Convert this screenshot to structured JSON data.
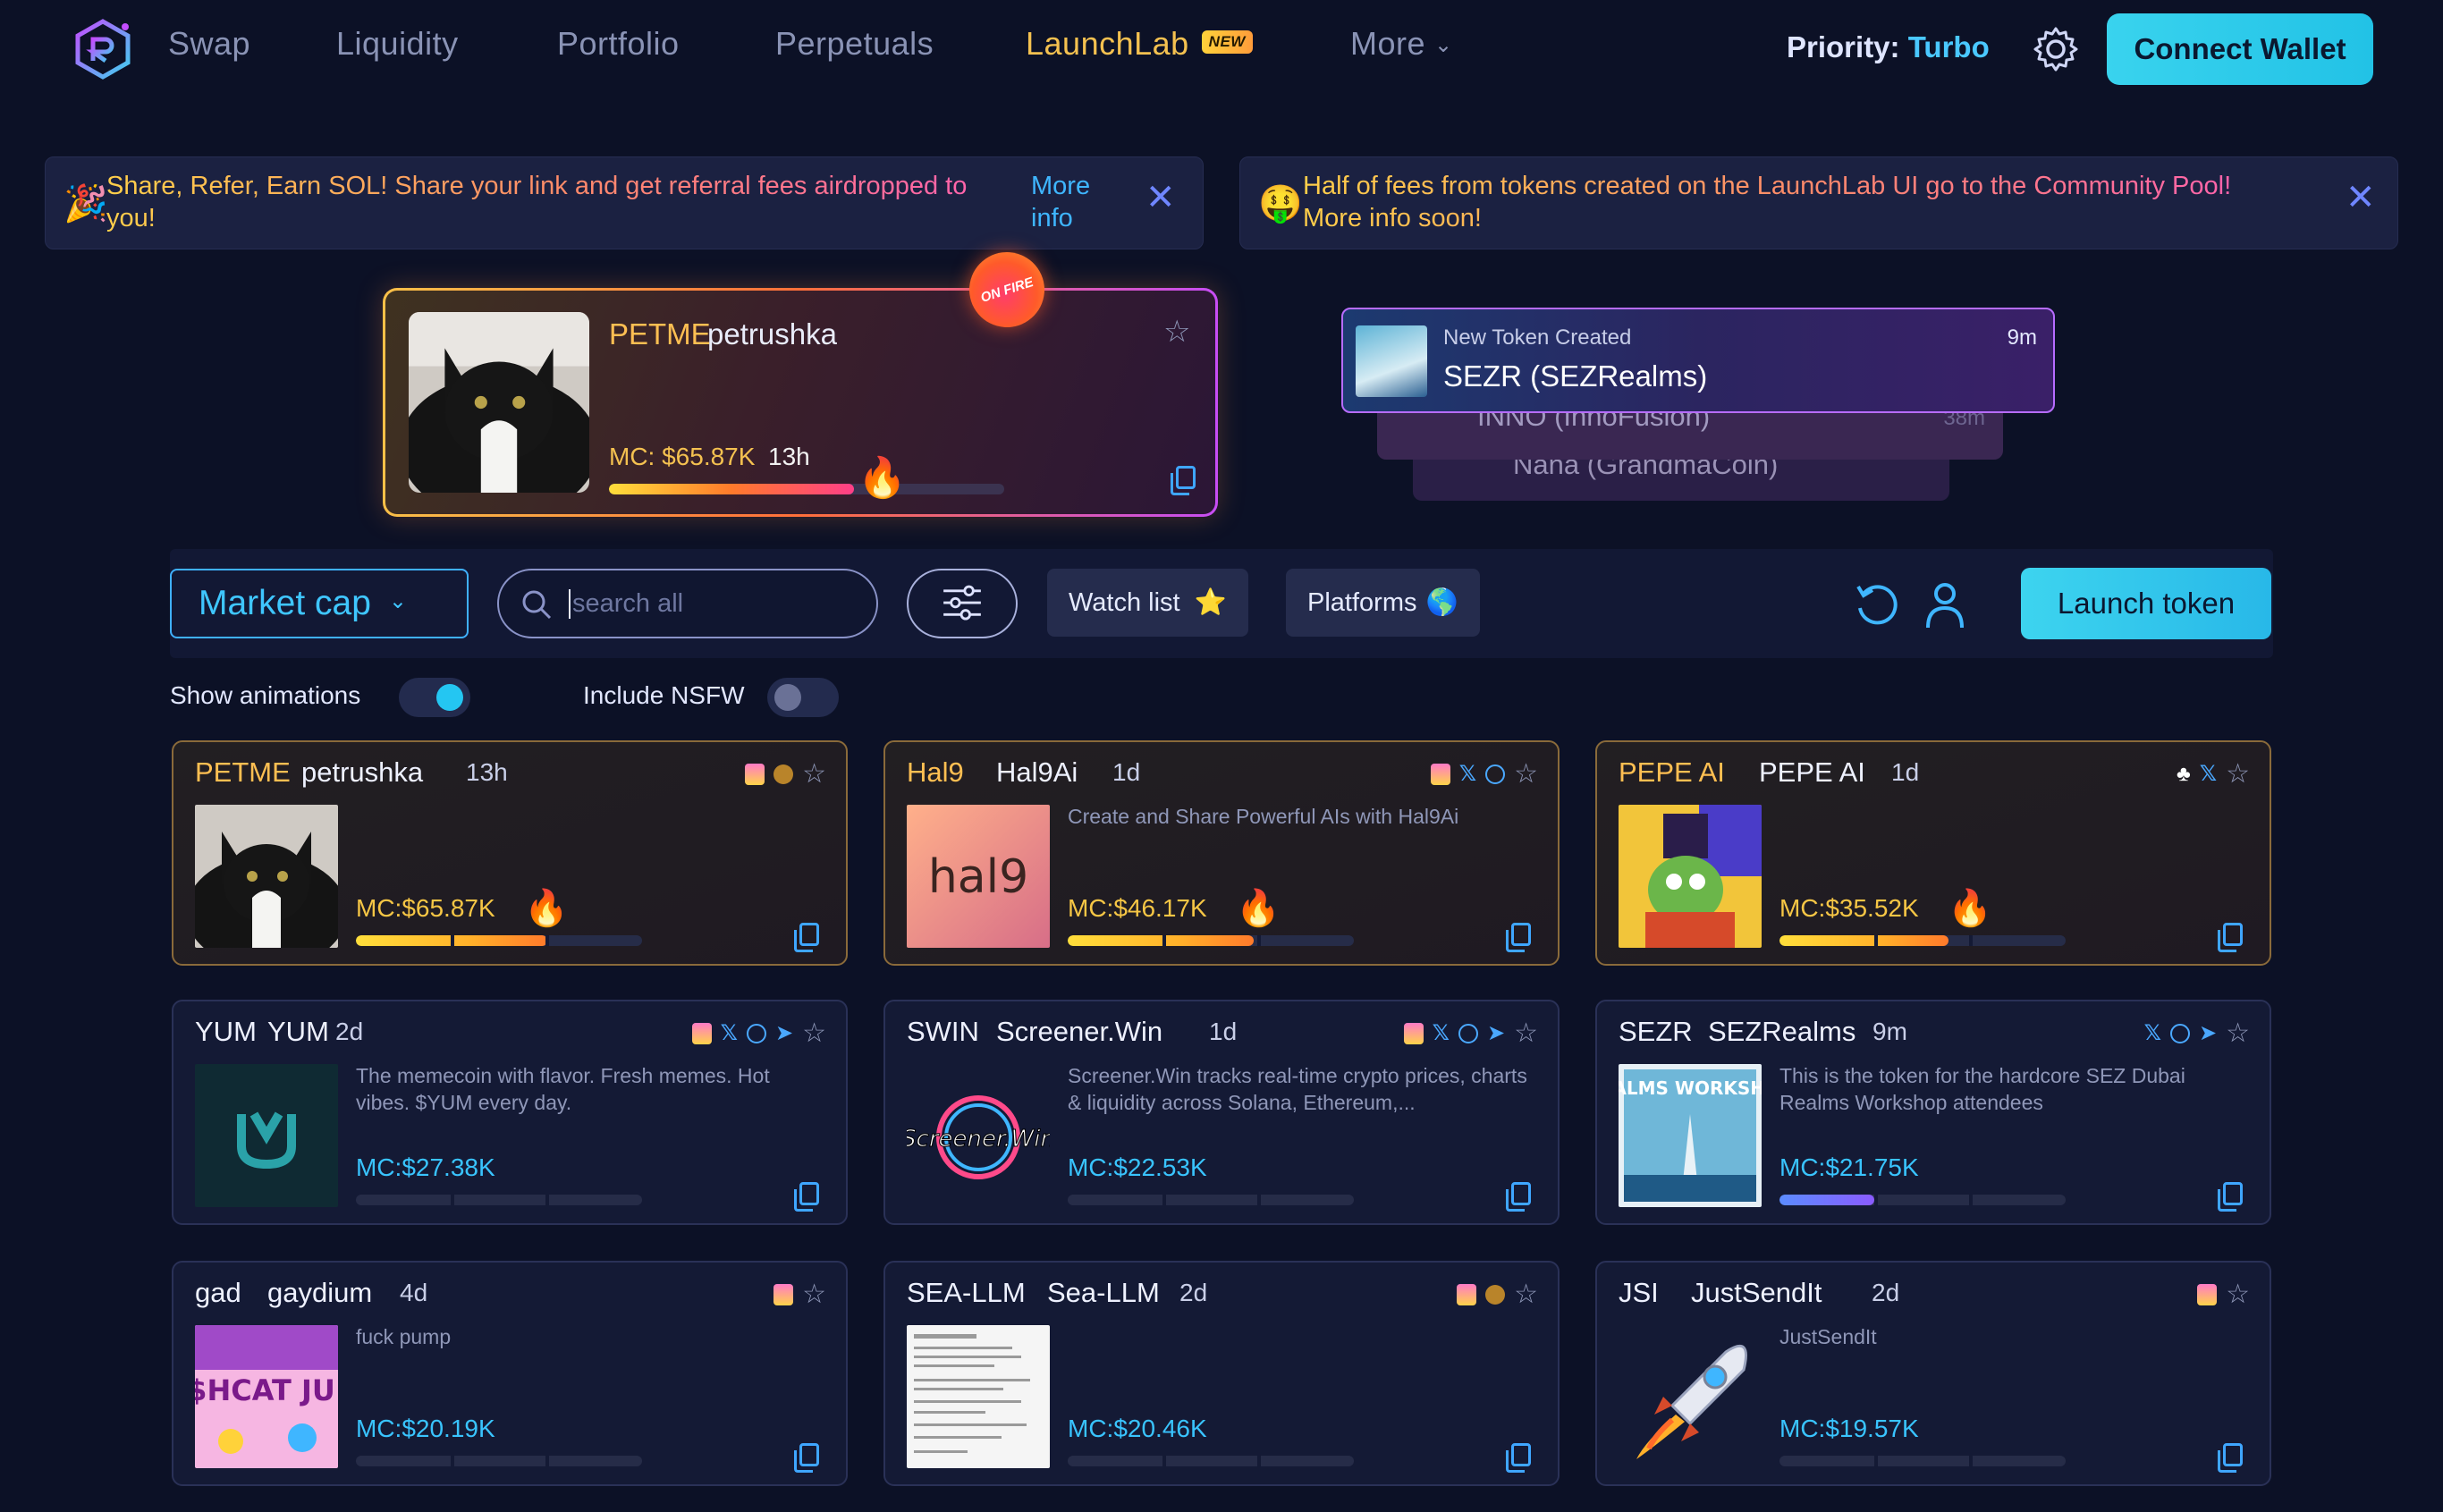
{
  "nav": {
    "items": [
      "Swap",
      "Liquidity",
      "Portfolio",
      "Perpetuals",
      "LaunchLab",
      "More"
    ],
    "new_badge": "NEW",
    "priority_label": "Priority:",
    "priority_value": "Turbo",
    "connect_wallet": "Connect Wallet"
  },
  "banners": [
    {
      "emoji": "🎉",
      "text_line1": "Share, Refer, Earn SOL! Share your link and get referral fees airdropped to",
      "text_line2": "you!",
      "more": "More info"
    },
    {
      "emoji": "🤑",
      "text_line1": "Half of fees from tokens created on the LaunchLab UI go to the Community Pool!",
      "text_line2": "More info soon!"
    }
  ],
  "featured": {
    "ticker": "PETME",
    "name": "petrushka",
    "mc": "MC: $65.87K",
    "age": "13h",
    "progress": 0.62,
    "badge": "ON FIRE"
  },
  "feed": {
    "label": "New Token Created",
    "current": "SEZR (SEZRealms)",
    "current_age": "9m",
    "prev1": "INNO (InnoFusion)",
    "prev1_age": "38m",
    "prev2": "Nana (GrandmaCoin)"
  },
  "toolbar": {
    "sort": "Market cap",
    "search_placeholder": "search all",
    "watchlist": "Watch list",
    "platforms": "Platforms",
    "launch": "Launch token",
    "show_animations": "Show animations",
    "include_nsfw": "Include NSFW"
  },
  "cards": [
    {
      "ticker": "PETME",
      "name": "petrushka",
      "age": "13h",
      "desc": "",
      "mc": "MC:$65.87K",
      "progress": 0.67,
      "hot": true,
      "icons": [
        "pump",
        "coin"
      ]
    },
    {
      "ticker": "Hal9",
      "name": "Hal9Ai",
      "age": "1d",
      "desc": "Create and Share Powerful AIs with Hal9Ai",
      "mc": "MC:$46.17K",
      "progress": 0.65,
      "hot": true,
      "icons": [
        "pump",
        "x",
        "web"
      ]
    },
    {
      "ticker": "PEPE AI",
      "name": "PEPE AI",
      "age": "1d",
      "desc": "",
      "mc": "MC:$35.52K",
      "progress": 0.59,
      "hot": true,
      "icons": [
        "clover",
        "x"
      ]
    },
    {
      "ticker": "YUM",
      "name": "YUM",
      "age": "2d",
      "desc": "The memecoin with flavor. Fresh memes.  Hot vibes.  $YUM every day.",
      "mc": "MC:$27.38K",
      "progress": 0,
      "hot": false,
      "icons": [
        "pump",
        "x",
        "web",
        "tg"
      ]
    },
    {
      "ticker": "SWIN",
      "name": "Screener.Win",
      "age": "1d",
      "desc": "Screener.Win tracks real-time crypto prices, charts & liquidity across Solana, Ethereum,...",
      "mc": "MC:$22.53K",
      "progress": 0,
      "hot": false,
      "icons": [
        "pump",
        "x",
        "web",
        "tg"
      ]
    },
    {
      "ticker": "SEZR",
      "name": "SEZRealms",
      "age": "9m",
      "desc": "This is the token for the hardcore SEZ Dubai Realms Workshop attendees",
      "mc": "MC:$21.75K",
      "progress": 0.33,
      "hot": false,
      "icons": [
        "x",
        "web",
        "tg"
      ]
    },
    {
      "ticker": "gad",
      "name": "gaydium",
      "age": "4d",
      "desc": "fuck pump",
      "mc": "MC:$20.19K",
      "progress": 0,
      "hot": false,
      "icons": [
        "pump"
      ]
    },
    {
      "ticker": "SEA-LLM",
      "name": "Sea-LLM",
      "age": "2d",
      "desc": "",
      "mc": "MC:$20.46K",
      "progress": 0,
      "hot": false,
      "icons": [
        "pump",
        "coin"
      ]
    },
    {
      "ticker": "JSI",
      "name": "JustSendIt",
      "age": "2d",
      "desc": "JustSendIt",
      "mc": "MC:$19.57K",
      "progress": 0,
      "hot": false,
      "icons": [
        "pump"
      ]
    }
  ],
  "image_text": {
    "hal9": "hal9",
    "swin": "Screener.Win",
    "sez": "REALMS WORKSHOP",
    "gad": "$HCAT JU"
  },
  "colors": {
    "accent": "#39d3ee",
    "gold": "#f4c150",
    "blue": "#39c4ff",
    "bg": "#0c1126"
  }
}
